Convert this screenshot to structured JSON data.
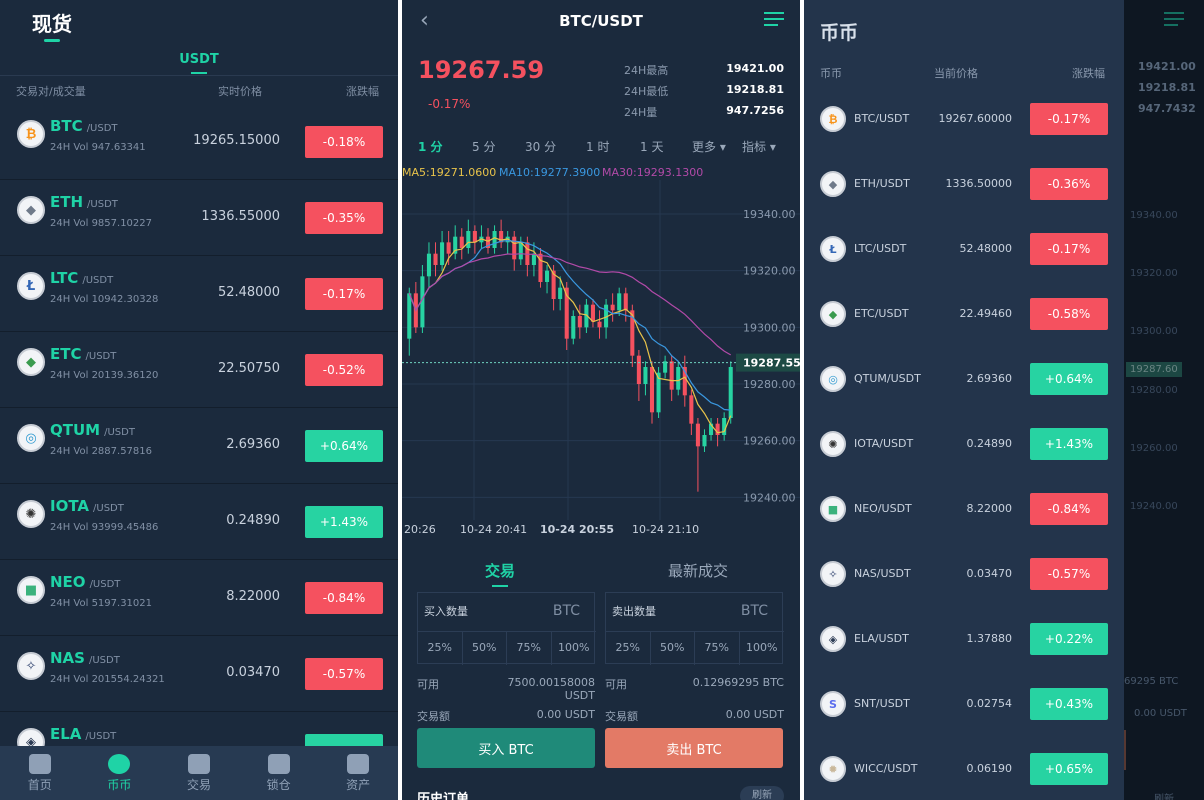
{
  "spot": {
    "title": "现货",
    "tab": "USDT",
    "headers": {
      "pair": "交易对/成交量",
      "price": "实时价格",
      "change": "涨跌幅"
    },
    "rows": [
      {
        "sym": "BTC",
        "quote": "/USDT",
        "vol": "24H Vol 947.63341",
        "price": "19265.15000",
        "change": "-0.18%",
        "dir": "down",
        "icon": "bitcoin-icon",
        "glyph": "₿",
        "color": "#f7931a"
      },
      {
        "sym": "ETH",
        "quote": "/USDT",
        "vol": "24H Vol 9857.10227",
        "price": "1336.55000",
        "change": "-0.35%",
        "dir": "down",
        "icon": "ethereum-icon",
        "glyph": "◆",
        "color": "#6f7a8a"
      },
      {
        "sym": "LTC",
        "quote": "/USDT",
        "vol": "24H Vol 10942.30328",
        "price": "52.48000",
        "change": "-0.17%",
        "dir": "down",
        "icon": "litecoin-icon",
        "glyph": "Ł",
        "color": "#3467b6"
      },
      {
        "sym": "ETC",
        "quote": "/USDT",
        "vol": "24H Vol 20139.36120",
        "price": "22.50750",
        "change": "-0.52%",
        "dir": "down",
        "icon": "ethereum-classic-icon",
        "glyph": "◆",
        "color": "#3a9b4f"
      },
      {
        "sym": "QTUM",
        "quote": "/USDT",
        "vol": "24H Vol 2887.57816",
        "price": "2.69360",
        "change": "+0.64%",
        "dir": "up",
        "icon": "qtum-icon",
        "glyph": "◎",
        "color": "#2e9ad0"
      },
      {
        "sym": "IOTA",
        "quote": "/USDT",
        "vol": "24H Vol 93999.45486",
        "price": "0.24890",
        "change": "+1.43%",
        "dir": "up",
        "icon": "iota-icon",
        "glyph": "✺",
        "color": "#333333"
      },
      {
        "sym": "NEO",
        "quote": "/USDT",
        "vol": "24H Vol 5197.31021",
        "price": "8.22000",
        "change": "-0.84%",
        "dir": "down",
        "icon": "neo-icon",
        "glyph": "■",
        "color": "#3bb27d"
      },
      {
        "sym": "NAS",
        "quote": "/USDT",
        "vol": "24H Vol 201554.24321",
        "price": "0.03470",
        "change": "-0.57%",
        "dir": "down",
        "icon": "nebulas-icon",
        "glyph": "✧",
        "color": "#2a3d6b"
      },
      {
        "sym": "ELA",
        "quote": "/USDT",
        "vol": "",
        "price": "",
        "change": "",
        "dir": "up",
        "icon": "elastos-icon",
        "glyph": "◈",
        "color": "#2c3b54"
      }
    ],
    "nav": [
      {
        "label": "首页",
        "icon": "home-icon",
        "active": false
      },
      {
        "label": "币币",
        "icon": "coin-exchange-icon",
        "active": true
      },
      {
        "label": "交易",
        "icon": "trade-icon",
        "active": false
      },
      {
        "label": "锁仓",
        "icon": "lock-position-icon",
        "active": false
      },
      {
        "label": "资产",
        "icon": "wallet-icon",
        "active": false
      }
    ]
  },
  "trade": {
    "title": "BTC/USDT",
    "price": "19267.59",
    "change": "-0.17%",
    "stats": [
      {
        "label": "24H最高",
        "value": "19421.00"
      },
      {
        "label": "24H最低",
        "value": "19218.81"
      },
      {
        "label": "24H量",
        "value": "947.7256"
      }
    ],
    "timeframes": [
      "1 分",
      "5 分",
      "30 分",
      "1 时",
      "1 天",
      "更多 ▾",
      "指标 ▾"
    ],
    "ma": [
      {
        "text": "MA5:19271.0600",
        "color": "#e8c34a"
      },
      {
        "text": "MA10:19277.3900",
        "color": "#3a98e0"
      },
      {
        "text": "MA30:19293.1300",
        "color": "#b24aa8"
      }
    ],
    "tabs": {
      "trade": "交易",
      "latest": "最新成交"
    },
    "buy": {
      "label": "买入数量",
      "coin": "BTC",
      "avail_label": "可用",
      "avail": "7500.00158008 USDT",
      "amount_label": "交易额",
      "amount": "0.00 USDT",
      "button": "买入 BTC"
    },
    "sell": {
      "label": "卖出数量",
      "coin": "BTC",
      "avail_label": "可用",
      "avail": "0.12969295 BTC",
      "amount_label": "交易额",
      "amount": "0.00 USDT",
      "button": "卖出 BTC"
    },
    "pcts": [
      "25%",
      "50%",
      "75%",
      "100%"
    ],
    "history": "历史订单",
    "refresh": "刷新"
  },
  "chart_data": {
    "type": "candlestick",
    "ylim": [
      19232,
      19352
    ],
    "yticks": [
      "19340.00",
      "19320.00",
      "19300.00",
      "19280.00",
      "19260.00",
      "19240.00"
    ],
    "ytick_values": [
      19340,
      19320,
      19300,
      19280,
      19260,
      19240
    ],
    "xticks": [
      "20:26",
      "10-24 20:41",
      "10-24 20:55",
      "10-24 21:10"
    ],
    "current_price": "19287.55",
    "current_value": 19287.55,
    "candles": [
      [
        19296,
        19312,
        19290,
        19314
      ],
      [
        19312,
        19300,
        19298,
        19316
      ],
      [
        19300,
        19318,
        19298,
        19322
      ],
      [
        19318,
        19326,
        19314,
        19330
      ],
      [
        19326,
        19322,
        19318,
        19330
      ],
      [
        19322,
        19330,
        19320,
        19334
      ],
      [
        19330,
        19326,
        19322,
        19334
      ],
      [
        19326,
        19332,
        19324,
        19336
      ],
      [
        19332,
        19328,
        19324,
        19335
      ],
      [
        19328,
        19334,
        19326,
        19338
      ],
      [
        19334,
        19330,
        19326,
        19336
      ],
      [
        19330,
        19332,
        19328,
        19336
      ],
      [
        19332,
        19328,
        19326,
        19335
      ],
      [
        19328,
        19334,
        19326,
        19336
      ],
      [
        19334,
        19330,
        19328,
        19338
      ],
      [
        19330,
        19332,
        19326,
        19334
      ],
      [
        19332,
        19324,
        19320,
        19334
      ],
      [
        19324,
        19330,
        19322,
        19332
      ],
      [
        19330,
        19322,
        19318,
        19332
      ],
      [
        19322,
        19326,
        19318,
        19330
      ],
      [
        19326,
        19316,
        19314,
        19328
      ],
      [
        19316,
        19320,
        19312,
        19322
      ],
      [
        19320,
        19310,
        19306,
        19322
      ],
      [
        19310,
        19314,
        19306,
        19318
      ],
      [
        19314,
        19296,
        19292,
        19316
      ],
      [
        19296,
        19304,
        19294,
        19306
      ],
      [
        19304,
        19300,
        19296,
        19308
      ],
      [
        19300,
        19308,
        19298,
        19310
      ],
      [
        19308,
        19302,
        19300,
        19310
      ],
      [
        19302,
        19300,
        19296,
        19306
      ],
      [
        19300,
        19308,
        19296,
        19310
      ],
      [
        19308,
        19306,
        19302,
        19312
      ],
      [
        19306,
        19312,
        19304,
        19314
      ],
      [
        19312,
        19306,
        19302,
        19314
      ],
      [
        19306,
        19290,
        19286,
        19308
      ],
      [
        19290,
        19280,
        19274,
        19292
      ],
      [
        19280,
        19286,
        19276,
        19288
      ],
      [
        19286,
        19270,
        19266,
        19288
      ],
      [
        19270,
        19284,
        19268,
        19286
      ],
      [
        19284,
        19288,
        19282,
        19290
      ],
      [
        19288,
        19278,
        19274,
        19290
      ],
      [
        19278,
        19286,
        19276,
        19288
      ],
      [
        19286,
        19276,
        19272,
        19290
      ],
      [
        19276,
        19266,
        19262,
        19278
      ],
      [
        19266,
        19258,
        19242,
        19268
      ],
      [
        19258,
        19262,
        19256,
        19264
      ],
      [
        19262,
        19266,
        19260,
        19268
      ],
      [
        19266,
        19262,
        19258,
        19268
      ],
      [
        19262,
        19268,
        19260,
        19270
      ],
      [
        19268,
        19286,
        19266,
        19288
      ]
    ]
  },
  "drawer": {
    "title": "币币",
    "headers": {
      "name": "币币",
      "price": "当前价格",
      "change": "涨跌幅"
    },
    "rows": [
      {
        "name": "BTC/USDT",
        "price": "19267.60000",
        "change": "-0.17%",
        "dir": "down",
        "icon": "bitcoin-icon",
        "glyph": "₿",
        "color": "#f7931a"
      },
      {
        "name": "ETH/USDT",
        "price": "1336.50000",
        "change": "-0.36%",
        "dir": "down",
        "icon": "ethereum-icon",
        "glyph": "◆",
        "color": "#6f7a8a"
      },
      {
        "name": "LTC/USDT",
        "price": "52.48000",
        "change": "-0.17%",
        "dir": "down",
        "icon": "litecoin-icon",
        "glyph": "Ł",
        "color": "#3467b6"
      },
      {
        "name": "ETC/USDT",
        "price": "22.49460",
        "change": "-0.58%",
        "dir": "down",
        "icon": "ethereum-classic-icon",
        "glyph": "◆",
        "color": "#3a9b4f"
      },
      {
        "name": "QTUM/USDT",
        "price": "2.69360",
        "change": "+0.64%",
        "dir": "up",
        "icon": "qtum-icon",
        "glyph": "◎",
        "color": "#2e9ad0"
      },
      {
        "name": "IOTA/USDT",
        "price": "0.24890",
        "change": "+1.43%",
        "dir": "up",
        "icon": "iota-icon",
        "glyph": "✺",
        "color": "#333333"
      },
      {
        "name": "NEO/USDT",
        "price": "8.22000",
        "change": "-0.84%",
        "dir": "down",
        "icon": "neo-icon",
        "glyph": "■",
        "color": "#3bb27d"
      },
      {
        "name": "NAS/USDT",
        "price": "0.03470",
        "change": "-0.57%",
        "dir": "down",
        "icon": "nebulas-icon",
        "glyph": "✧",
        "color": "#2a3d6b"
      },
      {
        "name": "ELA/USDT",
        "price": "1.37880",
        "change": "+0.22%",
        "dir": "up",
        "icon": "elastos-icon",
        "glyph": "◈",
        "color": "#2c3b54"
      },
      {
        "name": "SNT/USDT",
        "price": "0.02754",
        "change": "+0.43%",
        "dir": "up",
        "icon": "status-icon",
        "glyph": "S",
        "color": "#5b6dee"
      },
      {
        "name": "WICC/USDT",
        "price": "0.06190",
        "change": "+0.65%",
        "dir": "up",
        "icon": "waykichain-icon",
        "glyph": "✹",
        "color": "#c9b79a"
      }
    ],
    "behind": {
      "high": "19421.00",
      "low": "19218.81",
      "vol": "947.7432",
      "price": "19287.60",
      "ticks": [
        "19340.00",
        "19320.00",
        "19300.00",
        "19280.00",
        "19260.00",
        "19240.00"
      ],
      "avail": "69295 BTC",
      "amount": "0.00 USDT",
      "refresh": "刷新"
    }
  }
}
